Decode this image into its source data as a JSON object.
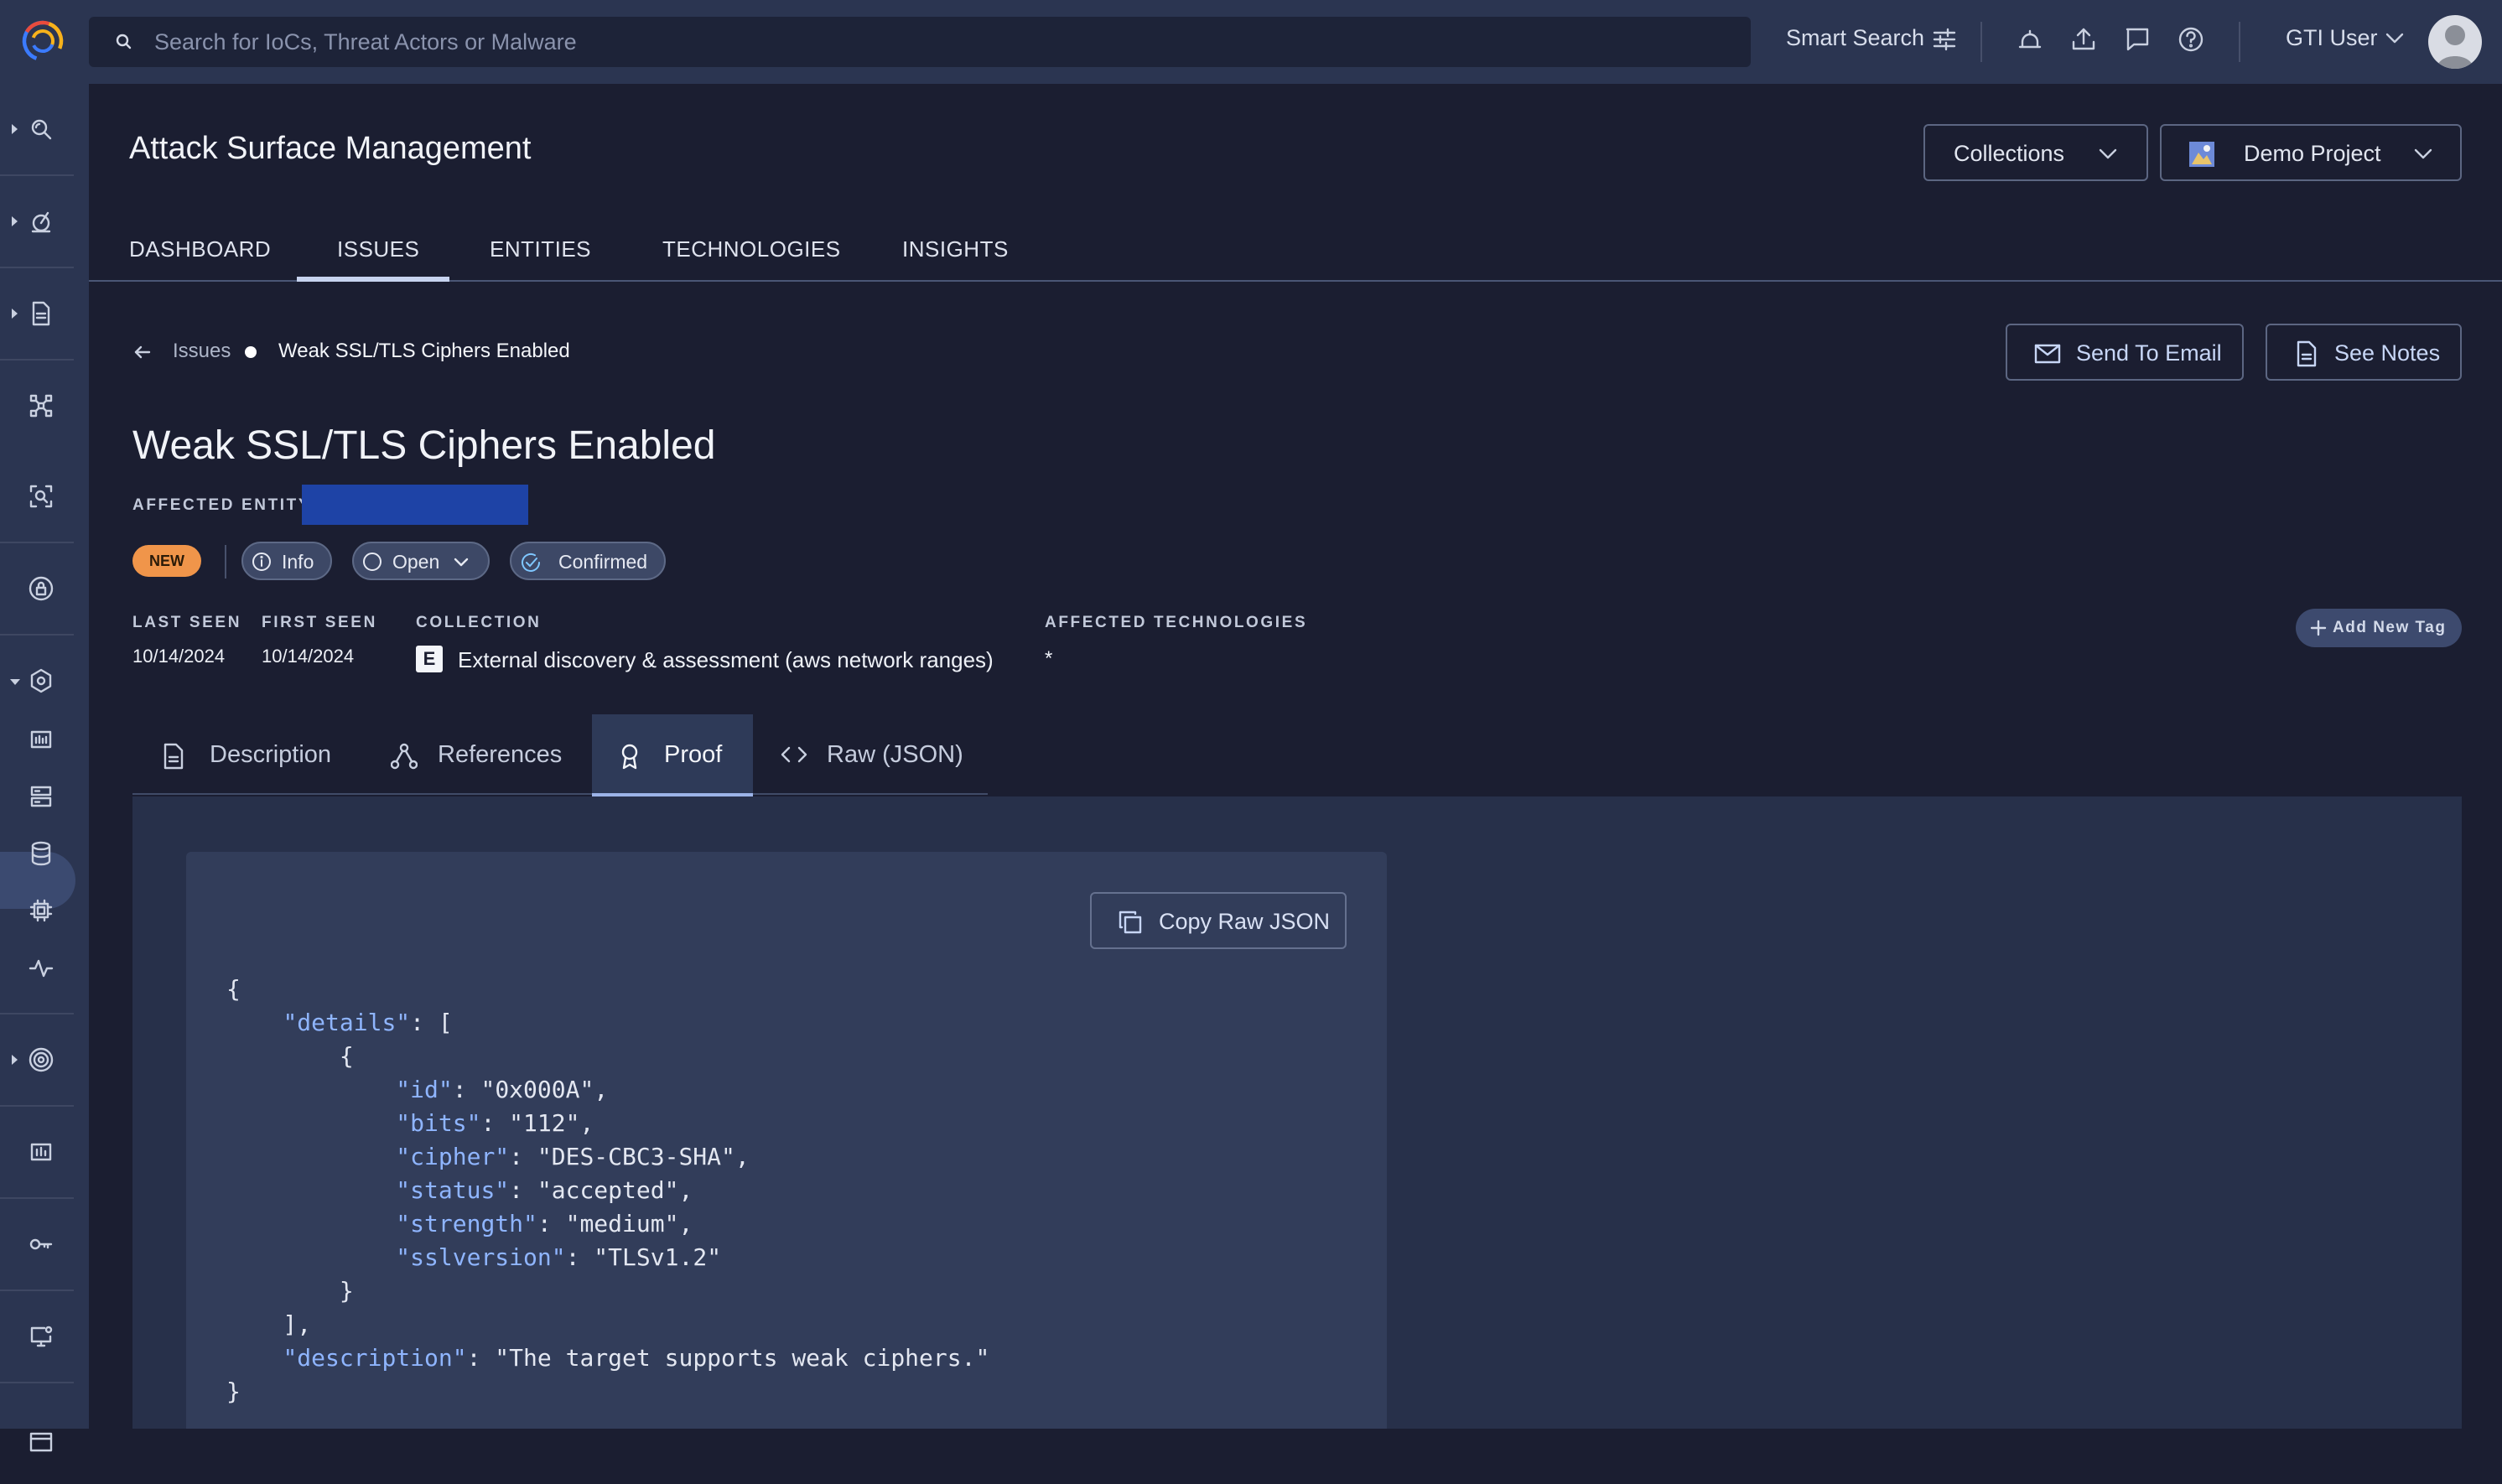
{
  "search": {
    "placeholder": "Search for IoCs, Threat Actors or Malware"
  },
  "topbar": {
    "smart_search": "Smart Search",
    "user": "GTI User"
  },
  "app": {
    "title": "Attack Surface Management"
  },
  "header_buttons": {
    "collections": "Collections",
    "project": "Demo Project"
  },
  "nav_tabs": [
    "DASHBOARD",
    "ISSUES",
    "ENTITIES",
    "TECHNOLOGIES",
    "INSIGHTS"
  ],
  "breadcrumb": {
    "parent": "Issues",
    "current": "Weak SSL/TLS Ciphers Enabled"
  },
  "actions": {
    "send_email": "Send To Email",
    "see_notes": "See Notes"
  },
  "issue": {
    "title": "Weak SSL/TLS Ciphers Enabled",
    "affected_entity_label": "AFFECTED ENTITY",
    "badge_new": "NEW",
    "severity": "Info",
    "status": "Open",
    "confirmation": "Confirmed"
  },
  "meta": {
    "last_seen_label": "LAST SEEN",
    "last_seen": "10/14/2024",
    "first_seen_label": "FIRST SEEN",
    "first_seen": "10/14/2024",
    "collection_label": "COLLECTION",
    "collection_badge": "E",
    "collection": "External discovery & assessment (aws network ranges)",
    "tech_label": "AFFECTED TECHNOLOGIES",
    "tech_value": "*",
    "add_tag": "Add New Tag"
  },
  "detail_tabs": {
    "description": "Description",
    "references": "References",
    "proof": "Proof",
    "raw": "Raw (JSON)"
  },
  "proof": {
    "copy_label": "Copy Raw JSON",
    "details": [
      {
        "id": "0x000A",
        "bits": "112",
        "cipher": "DES-CBC3-SHA",
        "status": "accepted",
        "strength": "medium",
        "sslversion": "TLSv1.2"
      }
    ],
    "description": "The target supports weak ciphers."
  },
  "colors": {
    "background": "#1b1e31",
    "topbar": "#2b3551",
    "accent_new": "#f0954a",
    "json_key": "#8fb5ff",
    "redaction": "#1e43a6"
  }
}
